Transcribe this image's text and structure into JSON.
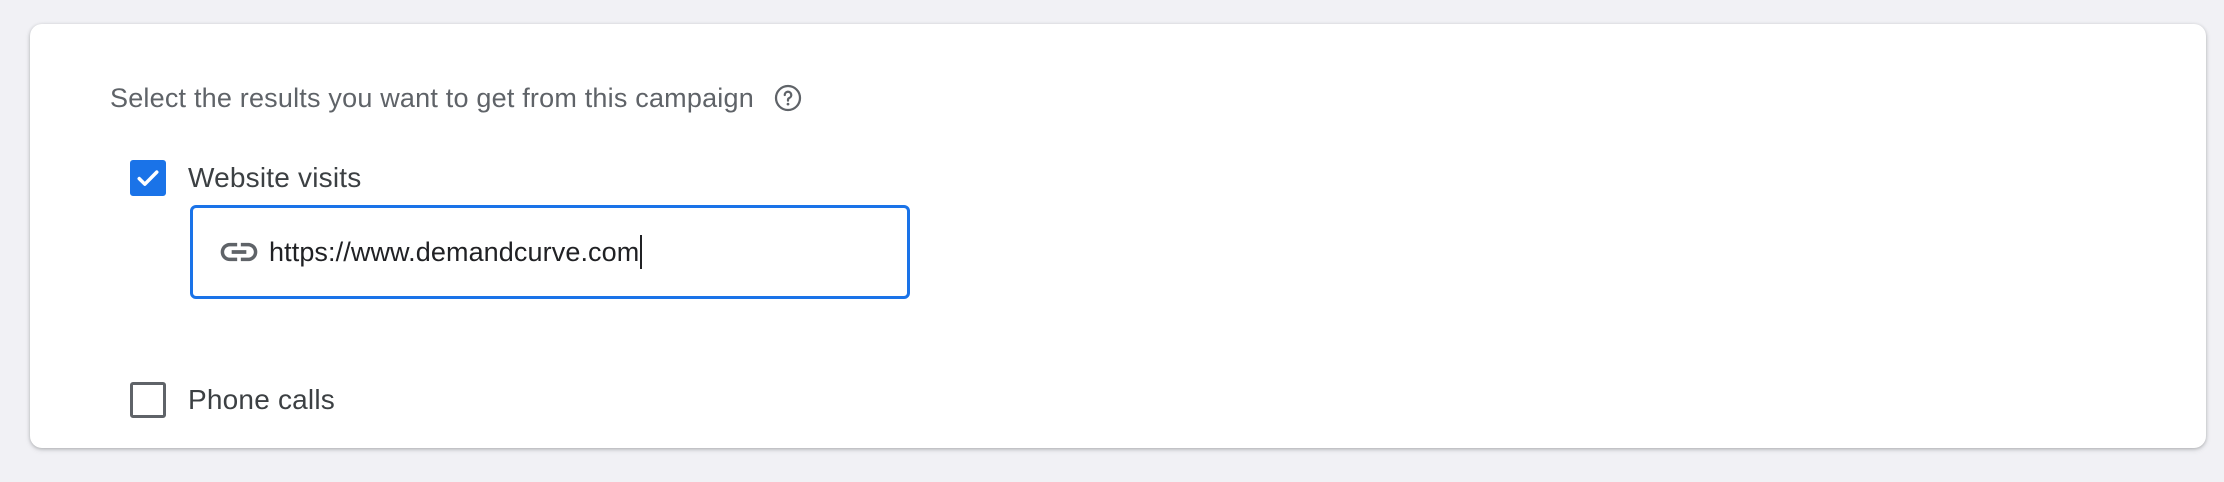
{
  "section": {
    "question": "Select the results you want to get from this campaign",
    "help_icon": "help-circle-icon"
  },
  "options": [
    {
      "label": "Website visits",
      "checked": true
    },
    {
      "label": "Phone calls",
      "checked": false
    }
  ],
  "website_field": {
    "value": "https://www.demandcurve.com",
    "icon": "link-icon",
    "focused": true
  },
  "colors": {
    "accent": "#1a73e8",
    "text": "#3c4043",
    "secondary_text": "#5f6368",
    "background": "#f1f1f5"
  }
}
